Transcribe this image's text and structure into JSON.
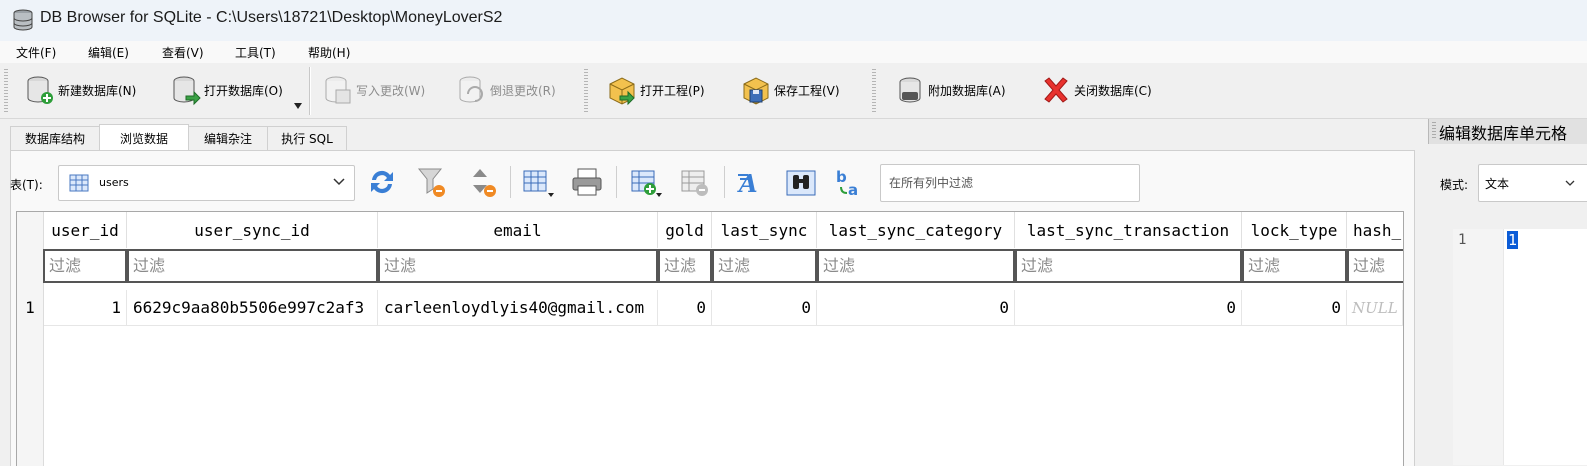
{
  "window": {
    "title": "DB Browser for SQLite - C:\\Users\\18721\\Desktop\\MoneyLoverS2"
  },
  "menu": [
    "文件(F)",
    "编辑(E)",
    "查看(V)",
    "工具(T)",
    "帮助(H)"
  ],
  "toolbar": {
    "new_db": "新建数据库(N)",
    "open_db": "打开数据库(O)",
    "write_changes": "写入更改(W)",
    "revert_changes": "倒退更改(R)",
    "open_project": "打开工程(P)",
    "save_project": "保存工程(V)",
    "attach_db": "附加数据库(A)",
    "close_db": "关闭数据库(C)"
  },
  "tabs": [
    "数据库结构",
    "浏览数据",
    "编辑杂注",
    "执行 SQL"
  ],
  "active_tab": "浏览数据",
  "browse": {
    "table_label": "表(T):",
    "table_value": "users",
    "filter_all_placeholder": "在所有列中过滤"
  },
  "grid": {
    "columns": [
      "user_id",
      "user_sync_id",
      "email",
      "gold",
      "last_sync",
      "last_sync_category",
      "last_sync_transaction",
      "lock_type",
      "hash_"
    ],
    "filter_placeholder": "过滤",
    "rows": [
      {
        "row_number": "1",
        "cells": [
          "1",
          "6629c9aa80b5506e997c2af3",
          "carleenloydlyis40@gmail.com",
          "0",
          "0",
          "0",
          "0",
          "0",
          "NULL"
        ]
      }
    ]
  },
  "dock": {
    "title": "编辑数据库单元格",
    "mode_label": "模式:",
    "mode_value": "文本",
    "line_number": "1",
    "cell_value": "1"
  },
  "colors": {
    "title_bar": "#eef3f9",
    "selection": "#0b5cd7",
    "null_text": "#bdbdbd",
    "close_red": "#e8322e"
  }
}
